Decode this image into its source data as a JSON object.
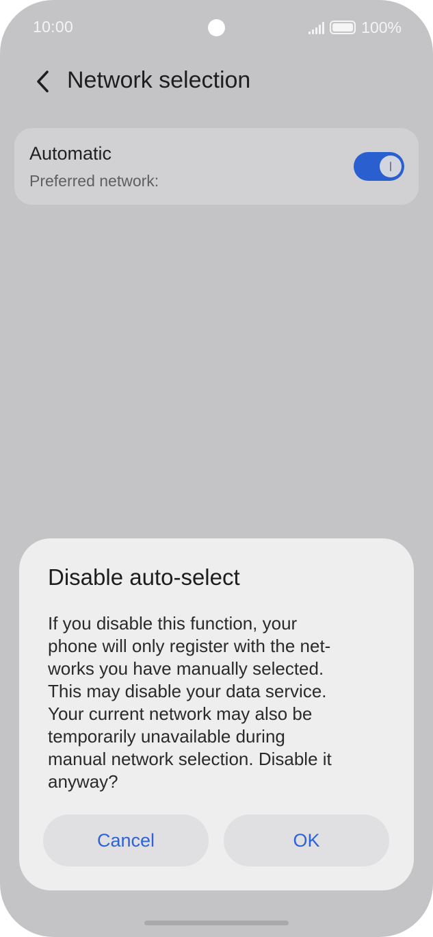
{
  "status_bar": {
    "time": "10:00",
    "battery": "100%",
    "icons": [
      "signal-icon",
      "battery-icon",
      "camera-cutout"
    ]
  },
  "header": {
    "title": "Network selection",
    "back_icon": "chevron-left-icon"
  },
  "setting": {
    "title": "Automatic",
    "subtitle": "Preferred network:",
    "toggle_on": true,
    "accent_color": "#2a5fd0"
  },
  "dialog": {
    "title": "Disable auto-select",
    "body_lines": [
      "If you disable this function, your",
      "phone will only register with the net-",
      "works you have manually selected.",
      "This may disable your data service.",
      "Your current network may also be",
      "temporarily unavailable during",
      "manual network selection. Disable it",
      "anyway?"
    ],
    "cancel_label": "Cancel",
    "ok_label": "OK",
    "button_text_color": "#2d63d6"
  }
}
